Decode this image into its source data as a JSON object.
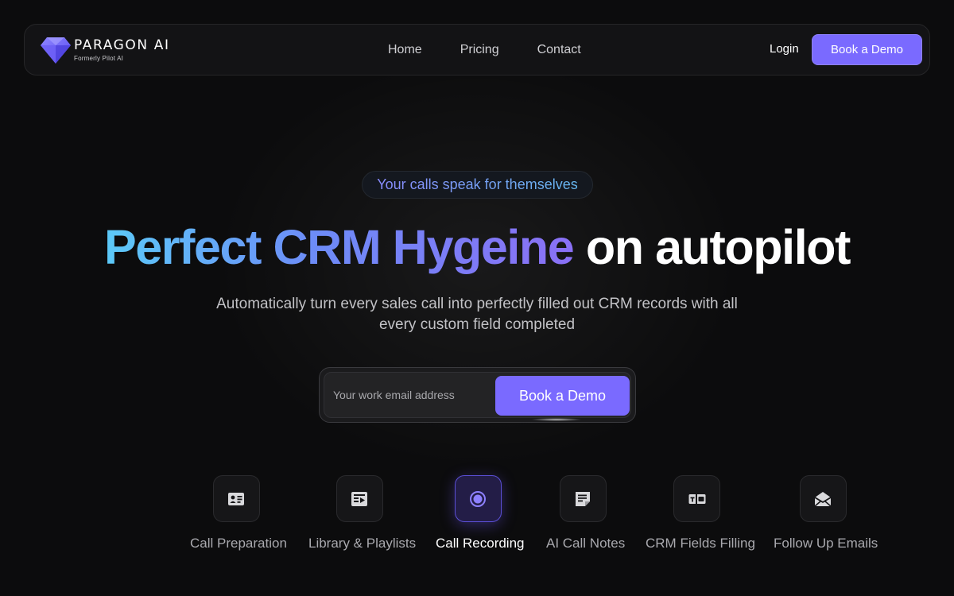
{
  "brand": {
    "name": "PARAGON AI",
    "subtitle": "Formerly Pilot AI",
    "accent": "#7a6aff"
  },
  "nav": {
    "links": [
      "Home",
      "Pricing",
      "Contact"
    ],
    "login_label": "Login",
    "cta_label": "Book a Demo"
  },
  "hero": {
    "badge": "Your calls speak for themselves",
    "headline_gradient": "Perfect CRM Hygeine",
    "headline_plain": "on autopilot",
    "subtext": "Automatically turn every sales call into perfectly filled out CRM records with all every custom field completed"
  },
  "form": {
    "email_placeholder": "Your work email address",
    "email_value": "",
    "cta_label": "Book a Demo"
  },
  "features": [
    {
      "label": "Call Preparation",
      "icon": "contact-card-icon",
      "active": false
    },
    {
      "label": "Library & Playlists",
      "icon": "playlist-icon",
      "active": false
    },
    {
      "label": "Call Recording",
      "icon": "record-icon",
      "active": true
    },
    {
      "label": "AI Call Notes",
      "icon": "notes-icon",
      "active": false
    },
    {
      "label": "CRM Fields Filling",
      "icon": "fields-icon",
      "active": false
    },
    {
      "label": "Follow Up Emails",
      "icon": "email-open-icon",
      "active": false
    }
  ]
}
